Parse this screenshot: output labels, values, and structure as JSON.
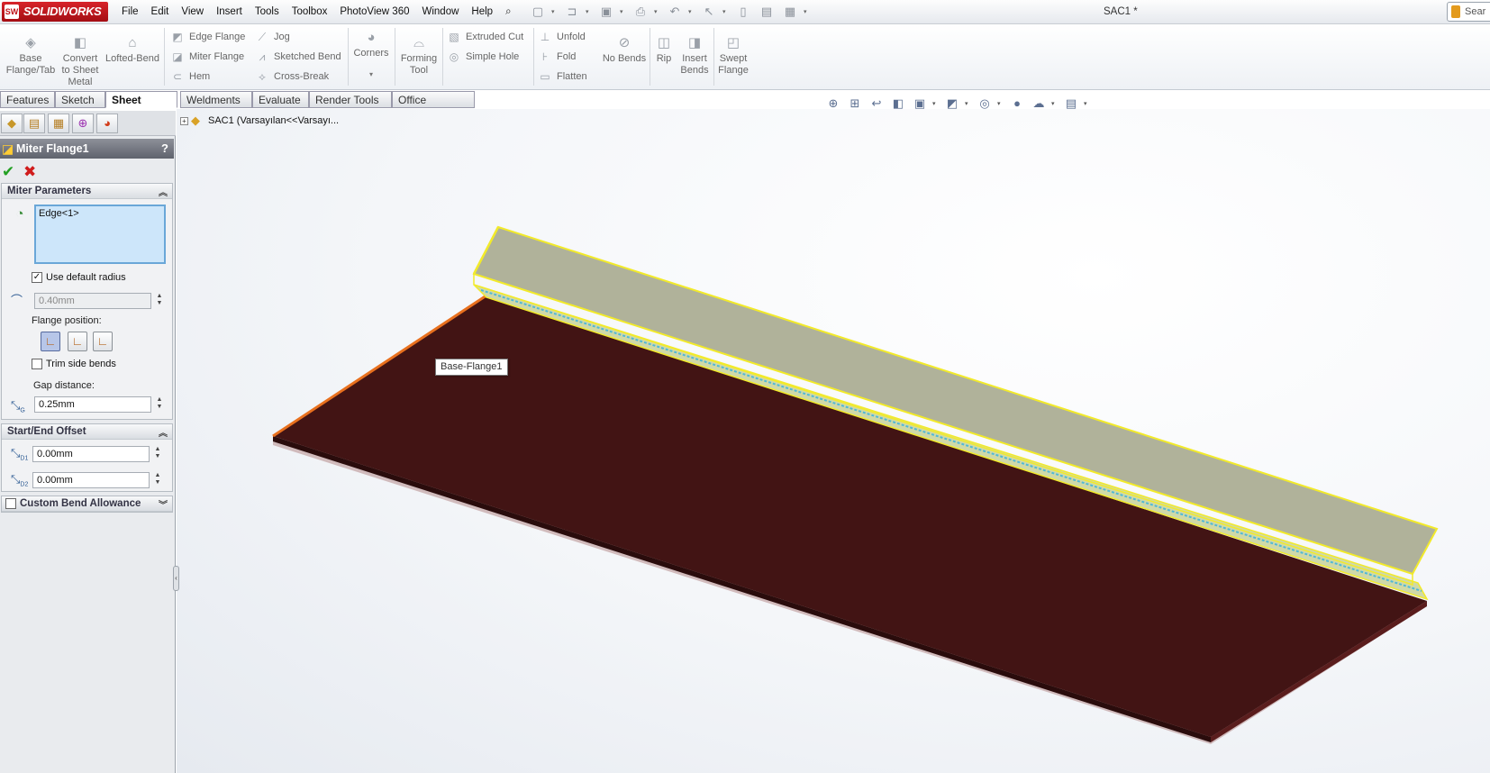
{
  "app": {
    "name": "SOLIDWORKS",
    "logo_badge": "SW",
    "document_title": "SAC1 *",
    "search_label": "Sear"
  },
  "menu": [
    "File",
    "Edit",
    "View",
    "Insert",
    "Tools",
    "Toolbox",
    "PhotoView 360",
    "Window",
    "Help"
  ],
  "ribbon": {
    "base_flange": "Base\nFlange/Tab",
    "convert": "Convert\nto Sheet\nMetal",
    "lofted_bend": "Lofted-Bend",
    "edge_flange": "Edge Flange",
    "miter_flange": "Miter Flange",
    "hem": "Hem",
    "jog": "Jog",
    "sketched_bend": "Sketched Bend",
    "cross_break": "Cross-Break",
    "corners": "Corners",
    "forming_tool": "Forming\nTool",
    "extruded_cut": "Extruded Cut",
    "simple_hole": "Simple Hole",
    "unfold": "Unfold",
    "fold": "Fold",
    "flatten": "Flatten",
    "no_bends": "No Bends",
    "rip": "Rip",
    "insert_bends": "Insert\nBends",
    "swept_flange": "Swept\nFlange"
  },
  "command_tabs": [
    "Features",
    "Sketch",
    "Sheet Metal",
    "Weldments",
    "Evaluate",
    "Render Tools",
    "Office Products"
  ],
  "active_tab": "Sheet Metal",
  "property_manager": {
    "title": "Miter Flange1",
    "help": "?",
    "miter_parameters": {
      "label": "Miter Parameters",
      "selection": "Edge<1>",
      "use_default_radius_label": "Use default radius",
      "use_default_radius_checked": true,
      "radius_value": "0.40mm",
      "flange_position_label": "Flange position:",
      "trim_side_bends_label": "Trim side bends",
      "trim_side_bends_checked": false,
      "gap_distance_label": "Gap distance:",
      "gap_distance_value": "0.25mm",
      "gap_icon_letter": "G"
    },
    "start_end_offset": {
      "label": "Start/End Offset",
      "d1_value": "0.00mm",
      "d2_value": "0.00mm",
      "d1_letter": "D1",
      "d2_letter": "D2"
    },
    "custom_bend_allowance": {
      "label": "Custom Bend Allowance",
      "checked": false
    }
  },
  "feature_tree": {
    "root": "SAC1  (Varsayılan<<Varsayı..."
  },
  "viewport": {
    "tooltip": "Base-Flange1"
  },
  "colors": {
    "plate": "#421414",
    "plate_edge": "#2a0c0c",
    "flange": "#b0b29a",
    "highlight": "#f2ea2a",
    "selected_edge": "#e8701e"
  },
  "icons": {
    "ok": "checkmark-icon",
    "cancel": "x-icon"
  }
}
